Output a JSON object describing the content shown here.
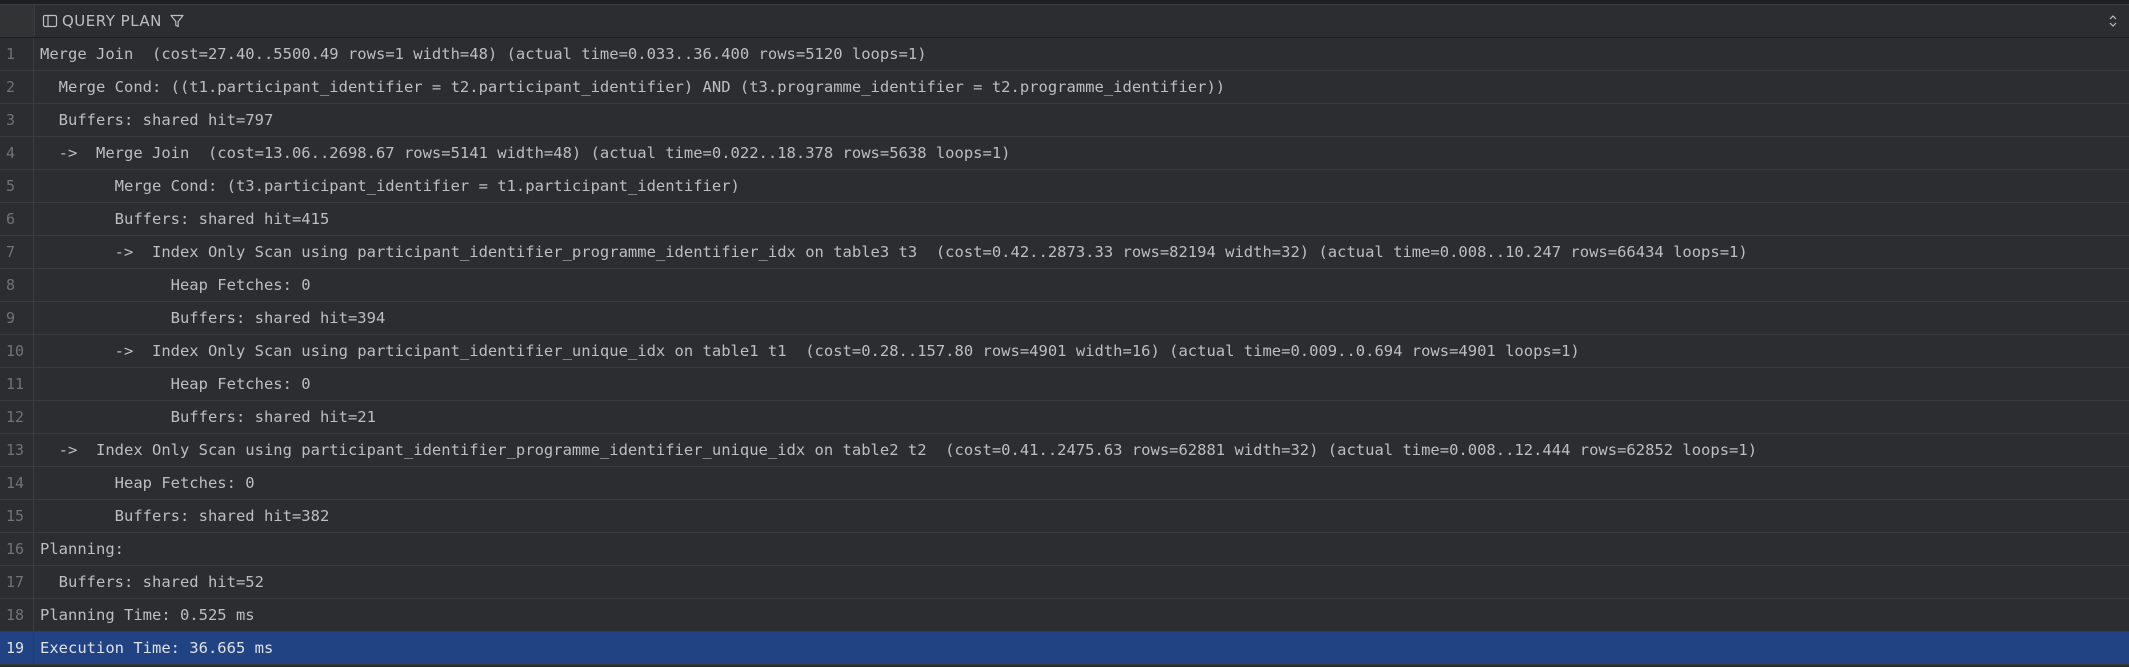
{
  "header": {
    "column_title": "QUERY PLAN",
    "icons": {
      "column": "table-column-icon",
      "filter": "filter-icon",
      "sort": "sort-icon"
    }
  },
  "colors": {
    "background": "#2b2d30",
    "text": "#bcbec4",
    "line_number": "#6f737a",
    "selection": "#214283"
  },
  "selected_row": 19,
  "rows": [
    {
      "n": "1",
      "text": "Merge Join  (cost=27.40..5500.49 rows=1 width=48) (actual time=0.033..36.400 rows=5120 loops=1)"
    },
    {
      "n": "2",
      "text": "  Merge Cond: ((t1.participant_identifier = t2.participant_identifier) AND (t3.programme_identifier = t2.programme_identifier))"
    },
    {
      "n": "3",
      "text": "  Buffers: shared hit=797"
    },
    {
      "n": "4",
      "text": "  ->  Merge Join  (cost=13.06..2698.67 rows=5141 width=48) (actual time=0.022..18.378 rows=5638 loops=1)"
    },
    {
      "n": "5",
      "text": "        Merge Cond: (t3.participant_identifier = t1.participant_identifier)"
    },
    {
      "n": "6",
      "text": "        Buffers: shared hit=415"
    },
    {
      "n": "7",
      "text": "        ->  Index Only Scan using participant_identifier_programme_identifier_idx on table3 t3  (cost=0.42..2873.33 rows=82194 width=32) (actual time=0.008..10.247 rows=66434 loops=1)"
    },
    {
      "n": "8",
      "text": "              Heap Fetches: 0"
    },
    {
      "n": "9",
      "text": "              Buffers: shared hit=394"
    },
    {
      "n": "10",
      "text": "        ->  Index Only Scan using participant_identifier_unique_idx on table1 t1  (cost=0.28..157.80 rows=4901 width=16) (actual time=0.009..0.694 rows=4901 loops=1)"
    },
    {
      "n": "11",
      "text": "              Heap Fetches: 0"
    },
    {
      "n": "12",
      "text": "              Buffers: shared hit=21"
    },
    {
      "n": "13",
      "text": "  ->  Index Only Scan using participant_identifier_programme_identifier_unique_idx on table2 t2  (cost=0.41..2475.63 rows=62881 width=32) (actual time=0.008..12.444 rows=62852 loops=1)"
    },
    {
      "n": "14",
      "text": "        Heap Fetches: 0"
    },
    {
      "n": "15",
      "text": "        Buffers: shared hit=382"
    },
    {
      "n": "16",
      "text": "Planning:"
    },
    {
      "n": "17",
      "text": "  Buffers: shared hit=52"
    },
    {
      "n": "18",
      "text": "Planning Time: 0.525 ms"
    },
    {
      "n": "19",
      "text": "Execution Time: 36.665 ms"
    }
  ]
}
